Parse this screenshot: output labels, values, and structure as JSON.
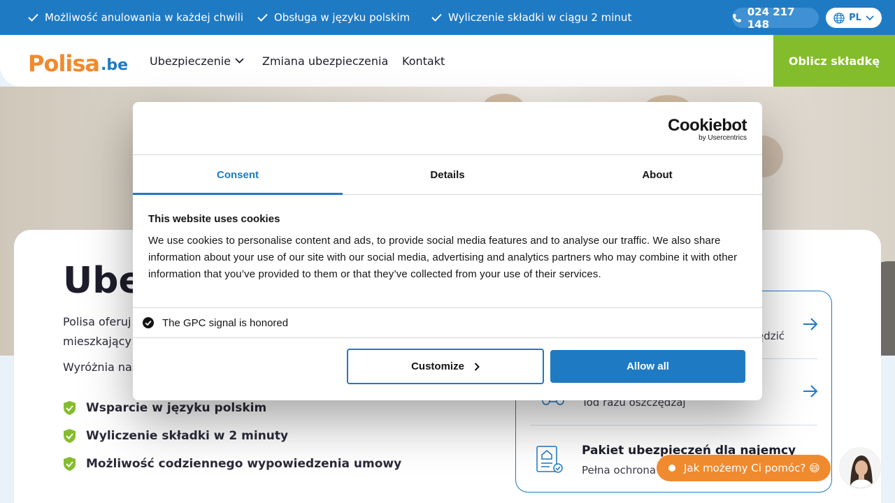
{
  "topbar": {
    "benefits": [
      "Możliwość anulowania w każdej chwili",
      "Obsługa w języku polskim",
      "Wyliczenie składki w ciągu 2 minut"
    ],
    "phone": "024 217 148",
    "lang": "PL"
  },
  "header": {
    "logo_main": "Polisa",
    "logo_suffix": ".be",
    "nav": [
      "Ubezpieczenie",
      "Zmiana ubezpieczenia",
      "Kontakt"
    ],
    "cta": "Oblicz składkę"
  },
  "content": {
    "headline": "Ube",
    "intro_line1": "Polisa oferuj",
    "intro_line2": "mieszkający",
    "intro2": "Wyróżnia nas",
    "checks": [
      "Wsparcie w języku polskim",
      "Wyliczenie składki w 2 minuty",
      "Możliwość codziennego wypowiedzenia umowy"
    ]
  },
  "products": {
    "item1_text": "ędzić",
    "item2_text": "Tod razu oszczędzaj",
    "item3_title": "Pakiet ubezpieczeń dla najemcy",
    "item3_text": "Pełna ochrona"
  },
  "cookie": {
    "logo_main": "Cookiebot",
    "logo_sub": "by Usercentrics",
    "tabs": [
      "Consent",
      "Details",
      "About"
    ],
    "title": "This website uses cookies",
    "body": "We use cookies to personalise content and ads, to provide social media features and to analyse our traffic. We also share information about your use of our site with our social media, advertising and analytics partners who may combine it with other information that you’ve provided to them or that they’ve collected from your use of their services.",
    "gpc": "The GPC signal is honored",
    "customize": "Customize",
    "allow_all": "Allow all"
  },
  "chat": {
    "label": "Jak możemy Ci pomóc? 😄"
  },
  "colors": {
    "brand_blue": "#1f7ac4",
    "brand_orange": "#f08a2e",
    "brand_green": "#84bd2b"
  }
}
